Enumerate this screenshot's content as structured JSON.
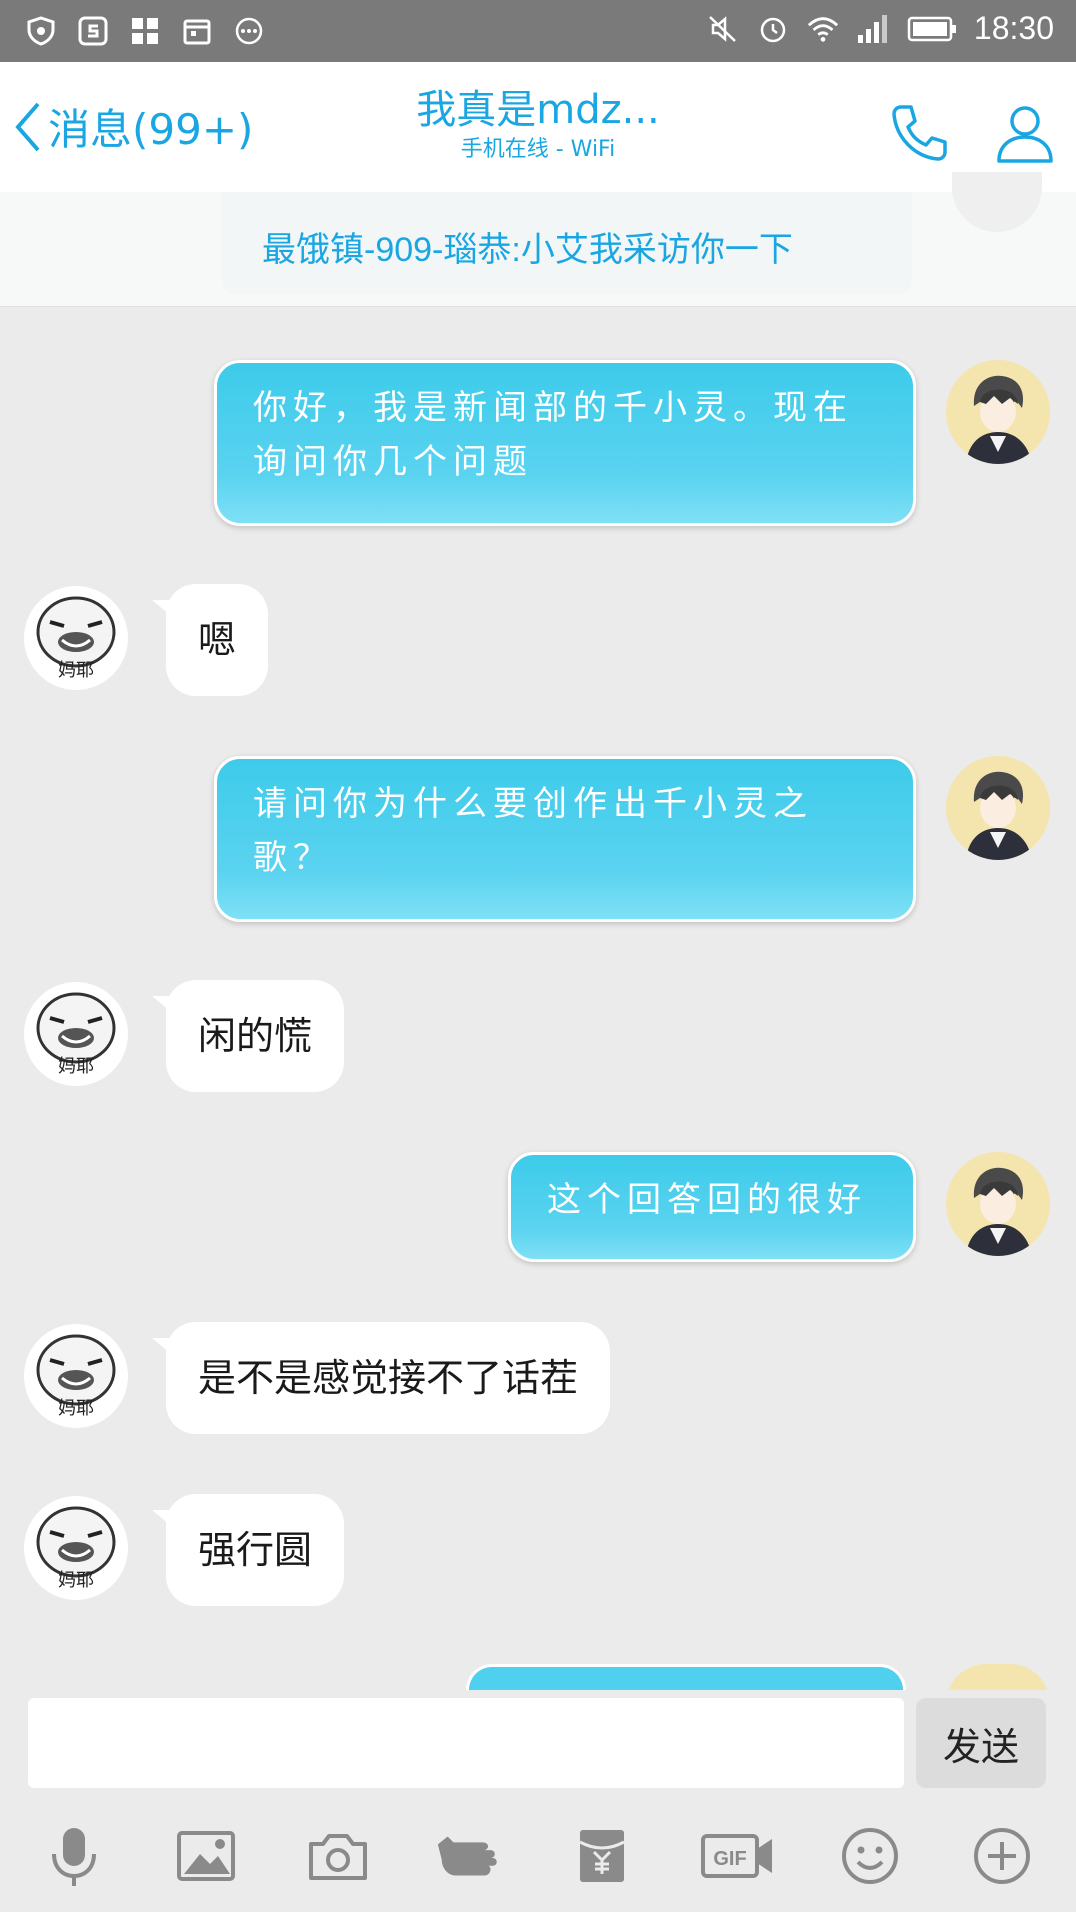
{
  "status_bar": {
    "time": "18:30"
  },
  "header": {
    "back_label": "消息(99+)",
    "title": "我真是mdz...",
    "subtitle": "手机在线 - WiFi"
  },
  "pinned": {
    "text": "最饿镇-909-瑙恭:小艾我采访你一下"
  },
  "messages": [
    {
      "side": "out",
      "text": "你好，我是新闻部的千小灵。现在询问你几个问题"
    },
    {
      "side": "in",
      "text": "嗯",
      "avatar_caption": "妈耶"
    },
    {
      "side": "out",
      "text": "请问你为什么要创作出千小灵之歌？"
    },
    {
      "side": "in",
      "text": "闲的慌",
      "avatar_caption": "妈耶"
    },
    {
      "side": "out",
      "text": "这个回答回的很好"
    },
    {
      "side": "in",
      "text": "是不是感觉接不了话茬",
      "avatar_caption": "妈耶"
    },
    {
      "side": "in",
      "text": "强行圆",
      "avatar_caption": "妈耶"
    }
  ],
  "composer": {
    "input_value": "",
    "send_label": "发送"
  },
  "toolbar_icons": [
    "microphone-icon",
    "image-icon",
    "camera-icon",
    "poke-hand-icon",
    "red-packet-icon",
    "gif-icon",
    "emoji-icon",
    "plus-icon"
  ],
  "colors": {
    "accent": "#19a6e3",
    "bubble_out": "#4fd0ee",
    "background": "#ebebeb"
  }
}
